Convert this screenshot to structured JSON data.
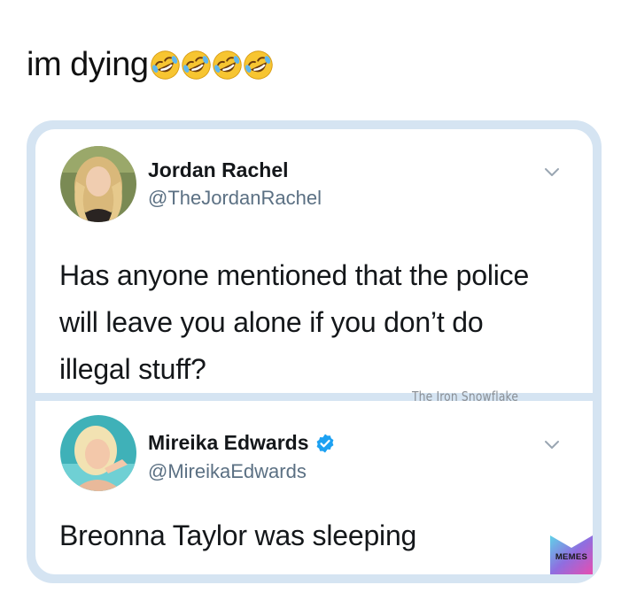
{
  "caption": {
    "text": "im dying",
    "emoji": [
      "laugh-icon",
      "laugh-icon",
      "laugh-icon",
      "laugh-icon"
    ]
  },
  "tweets": [
    {
      "display_name": "Jordan Rachel",
      "handle": "@TheJordanRachel",
      "verified": false,
      "text": "Has anyone mentioned that the police will leave you alone if you don’t do illegal stuff?"
    },
    {
      "display_name": "Mireika Edwards",
      "handle": "@MireikaEdwards",
      "verified": true,
      "text": "Breonna Taylor was sleeping"
    }
  ],
  "watermark": "The Iron Snowflake",
  "logo": {
    "text": "MEMES",
    "colors": [
      "#5fd3e8",
      "#8f6ee0",
      "#e64db0"
    ]
  },
  "colors": {
    "frame": "#d5e4f2",
    "handle": "#5b7083",
    "verified": "#1da1f2"
  }
}
